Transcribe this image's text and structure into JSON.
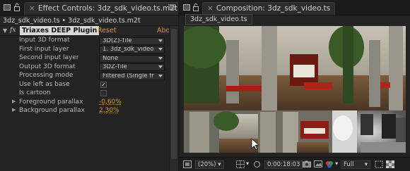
{
  "effect_controls": {
    "tab_title": "Effect Controls: 3dz_sdk_video.ts.m2t",
    "breadcrumb": "3dz_sdk_video.ts • 3dz_sdk_video.ts.m2t",
    "effect": {
      "fx_label": "fx",
      "name": "Triaxes DEEP Plugin",
      "reset": "Reset",
      "about": "Abo"
    },
    "properties": [
      {
        "label": "Input 3D format",
        "type": "select",
        "value": "3D(Z)-Tile"
      },
      {
        "label": "First input layer",
        "type": "select",
        "value": "1. 3dz_sdk_video"
      },
      {
        "label": "Second input layer",
        "type": "select",
        "value": "None"
      },
      {
        "label": "Output 3D format",
        "type": "select",
        "value": "3DZ-Tile"
      },
      {
        "label": "Processing mode",
        "type": "select",
        "value": "Filtered (Single fr"
      },
      {
        "label": "Use left as base",
        "type": "checkbox",
        "checked": true,
        "mark": "✓"
      },
      {
        "label": "Is cartoon",
        "type": "checkbox",
        "checked": false,
        "mark": ""
      },
      {
        "label": "Foreground parallax",
        "type": "value",
        "value": "-0,60%"
      },
      {
        "label": "Background parallax",
        "type": "value",
        "value": "2,30%"
      }
    ]
  },
  "composition": {
    "tab_title": "Composition: 3dz_sdk_video.ts",
    "sub_tab": "3dz_sdk_video.ts",
    "footer": {
      "zoom": "(20%)",
      "timecode": "0:00:18:03",
      "resolution": "Full"
    }
  },
  "colors": {
    "accent_orange": "#d99a2b",
    "panel_bg": "#232323"
  }
}
